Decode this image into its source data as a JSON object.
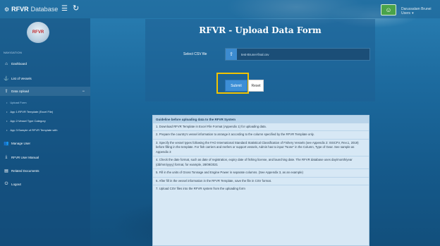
{
  "topbar": {
    "brand_mark": "⚙",
    "brand_bold": "RFVR",
    "brand_sub": "Database",
    "username": "Darussalam Brunei Users",
    "user_avatar": "☺"
  },
  "sidebar": {
    "logo_text": "RFVR",
    "heading": "NAVIGATION",
    "items": [
      {
        "label": "Dashboard",
        "icon": "home-icon",
        "glyph": "⌂"
      },
      {
        "label": "List of Vessels",
        "icon": "anchor-icon",
        "glyph": "⚓"
      },
      {
        "label": "Data Upload",
        "icon": "upload-icon",
        "glyph": "⇪"
      },
      {
        "label": "Manage User",
        "icon": "users-icon",
        "glyph": "👥"
      },
      {
        "label": "RFVR User Manual",
        "icon": "download-icon",
        "glyph": "⤓"
      },
      {
        "label": "Related Documents",
        "icon": "book-icon",
        "glyph": "▤"
      },
      {
        "label": "Logout",
        "icon": "power-icon",
        "glyph": "⏻"
      }
    ],
    "sub_items": [
      {
        "label": "Upload Form"
      },
      {
        "label": "App 1:RFVR Template (Excel File)"
      },
      {
        "label": "App 2:Vessel Type Category"
      },
      {
        "label": "App 3:Sample of RFVR Template with"
      }
    ]
  },
  "form": {
    "title": "RFVR - Upload Data Form",
    "csv_label": "Select CSV file",
    "file_name": "test-Brunei-final.csv",
    "submit_label": "Submit",
    "reset_label": "Reset"
  },
  "guidelines": {
    "title": "Guideline before uploading data to the RFVR System",
    "steps": [
      "1. Download RFVR Template in Excel File Format (Appendix 1) for uploading data.",
      "2. Prepare the country's vessel information to arrange it according to the column specified by the RFVR Template only.",
      "3. Specify the vessel types following the FAO International Standard Statistical Classification of Fishery Vessels (see Appendix 2: ISSCFV, Rev.1, 2019) before filling in the template. For fish carriers and reefers or support vessels, Admin has to input \"None\" in the Column, Type of Gear. See sample as Appendix 3",
      "4. Check the date format, such as date of registration, expiry date of fishing license, and launching date. The RFVR database uses day/month/year (dd/mm/yyyy) format, for example, 28/09/2021",
      "5. Fill in the units of Gross Tonnage and Engine Power in separate columns. (See Appendix 3, as an example)",
      "6. After fill in the vessel information in the RFVR Template, save the file in CSV format.",
      "7. Upload CSV files into the RFVR system from the uploading form"
    ]
  }
}
